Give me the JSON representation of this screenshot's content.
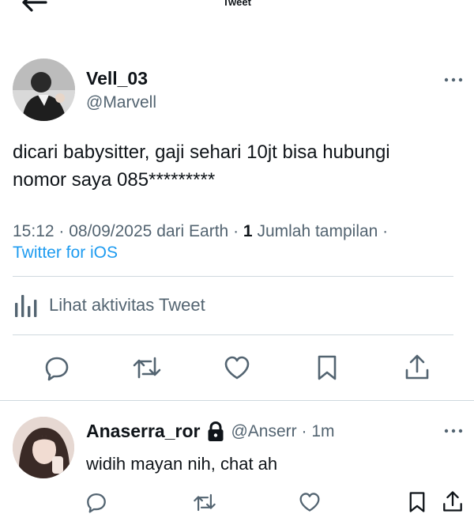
{
  "header": {
    "title": "Tweet",
    "back_icon": "arrow-left-icon"
  },
  "tweet": {
    "author": {
      "name": "Vell_03",
      "handle": "@Marvell",
      "avatar_icon": "avatar-photo"
    },
    "text_line1": "dicari babysitter, gaji sehari 10jt bisa hubungi",
    "text_line2": "nomor saya 085*********",
    "time": "15:12",
    "date": "08/09/2025",
    "location": "dari Earth",
    "views_count": "1",
    "views_label": "Jumlah tampilan",
    "source": "Twitter for iOS",
    "activity_label": "Lihat aktivitas Tweet",
    "actions": [
      "reply-icon",
      "retweet-icon",
      "like-icon",
      "bookmark-icon",
      "share-icon"
    ]
  },
  "reply": {
    "author": {
      "name": "Anaserra_ror",
      "handle": "@Anserr",
      "time": "1m",
      "protected": true
    },
    "text": "widih mayan nih, chat ah",
    "actions": [
      "reply-icon",
      "retweet-icon",
      "like-icon",
      "bookmark-icon",
      "share-icon"
    ]
  },
  "colors": {
    "text": "#0f1419",
    "secondary": "#536471",
    "link": "#1d9bf0",
    "divider": "#cfd9de"
  }
}
